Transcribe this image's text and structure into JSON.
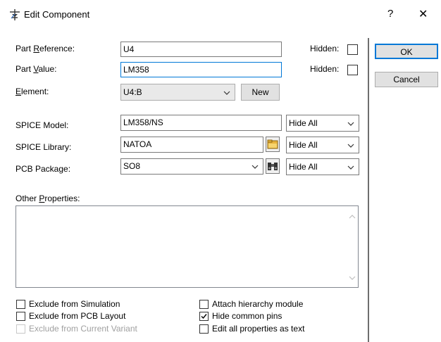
{
  "window": {
    "title": "Edit Component",
    "help_label": "?",
    "close_label": "✕",
    "app_icon": "component-icon"
  },
  "fields": {
    "part_reference": {
      "label_pre": "Part ",
      "label_key": "R",
      "label_post": "eference:",
      "value": "U4",
      "hidden_label": "Hidden:",
      "hidden_checked": false
    },
    "part_value": {
      "label_pre": "Part ",
      "label_key": "V",
      "label_post": "alue:",
      "value": "LM358",
      "hidden_label": "Hidden:",
      "hidden_checked": false
    },
    "element": {
      "label_key": "E",
      "label_post": "lement:",
      "value": "U4:B",
      "new_label": "New"
    },
    "spice_model": {
      "label": "SPICE Model:",
      "value": "LM358/NS",
      "visibility": "Hide All"
    },
    "spice_library": {
      "label": "SPICE Library:",
      "value": "NATOA",
      "visibility": "Hide All",
      "icon": "folder-icon"
    },
    "pcb_package": {
      "label": "PCB Package:",
      "value": "SO8",
      "visibility": "Hide All",
      "icon": "binoculars-icon"
    }
  },
  "other_properties": {
    "label_pre": "Other ",
    "label_key": "P",
    "label_post": "roperties:",
    "value": ""
  },
  "buttons": {
    "ok": "OK",
    "cancel": "Cancel"
  },
  "options": {
    "exclude_simulation": {
      "label": "Exclude from Simulation",
      "checked": false,
      "enabled": true
    },
    "exclude_pcb": {
      "label": "Exclude from PCB Layout",
      "checked": false,
      "enabled": true
    },
    "exclude_variant": {
      "label": "Exclude from Current Variant",
      "checked": false,
      "enabled": false
    },
    "attach_hierarchy": {
      "label": "Attach hierarchy module",
      "checked": false,
      "enabled": true
    },
    "hide_common_pins": {
      "label": "Hide common pins",
      "checked": true,
      "enabled": true
    },
    "edit_as_text": {
      "label": "Edit all properties as text",
      "checked": false,
      "enabled": true
    }
  },
  "colors": {
    "accent": "#0078d7",
    "folder": "#e8b33c"
  }
}
